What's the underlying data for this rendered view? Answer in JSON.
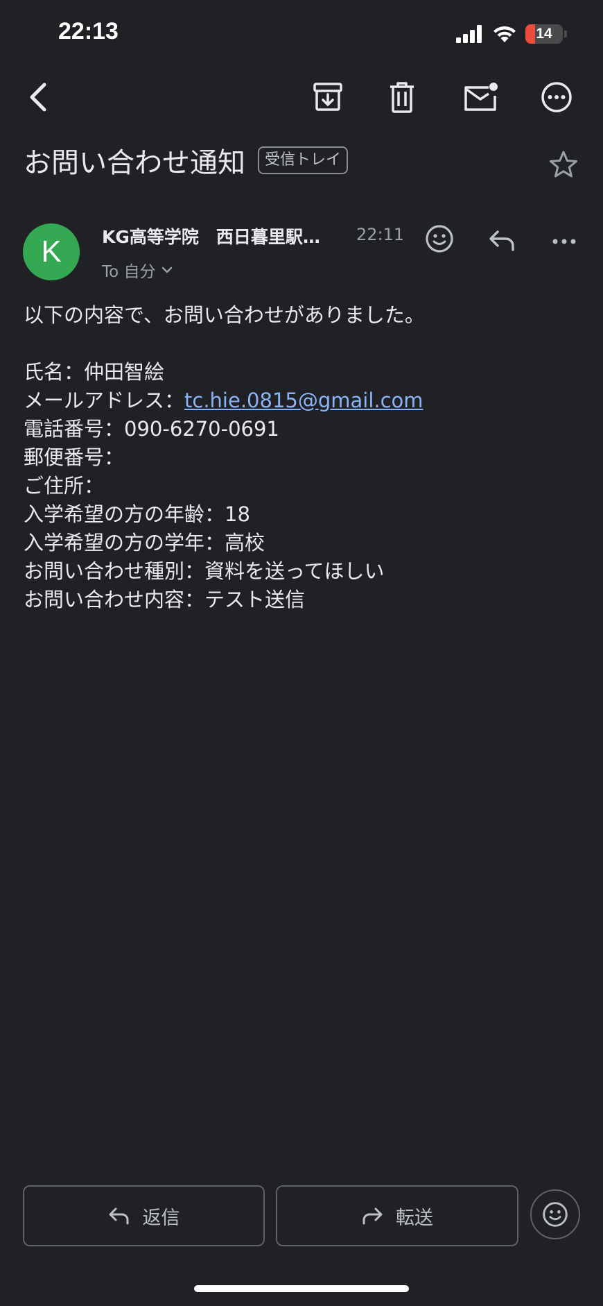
{
  "status_bar": {
    "time": "22:13",
    "battery": "14"
  },
  "toolbar": {
    "back_icon": "chevron-left-icon",
    "archive_icon": "archive-icon",
    "delete_icon": "trash-icon",
    "mark_unread_icon": "mail-unread-icon",
    "more_icon": "more-horizontal-circle-icon"
  },
  "email": {
    "subject": "お問い合わせ通知",
    "label": "受信トレイ",
    "sender": {
      "avatar_letter": "K",
      "avatar_color": "#34a853",
      "name": "KG高等学院　西日暮里駅…",
      "time": "22:11",
      "recipient": "To 自分"
    },
    "body": {
      "intro": "以下の内容で、お問い合わせがありました。",
      "name_line": "氏名：仲田智絵",
      "email_label": "メールアドレス：",
      "email_value": "tc.hie.0815@gmail.com",
      "phone_line": "電話番号：090-6270-0691",
      "postal_line": "郵便番号：",
      "address_line": "ご住所：",
      "age_line": "入学希望の方の年齢：18",
      "grade_line": "入学希望の方の学年：高校",
      "type_line": "お問い合わせ種別：資料を送ってほしい",
      "content_line": "お問い合わせ内容：テスト送信"
    }
  },
  "actions": {
    "reply_label": "返信",
    "forward_label": "転送"
  },
  "colors": {
    "background": "#202124",
    "link": "#8ab4f8",
    "accent_green": "#34a853",
    "battery_low": "#eb4d3d"
  }
}
